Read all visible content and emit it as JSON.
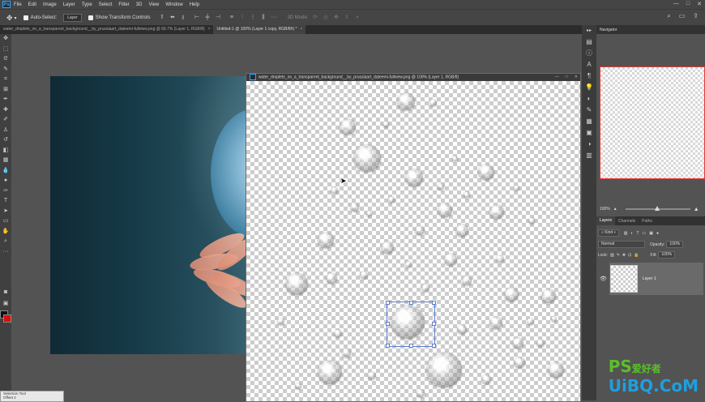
{
  "menu": [
    "File",
    "Edit",
    "Image",
    "Layer",
    "Type",
    "Select",
    "Filter",
    "3D",
    "View",
    "Window",
    "Help"
  ],
  "options": {
    "autoselect_label": "Auto-Select:",
    "autoselect_value": "Layer",
    "transform_label": "Show Transform Controls",
    "mode3d_label": "3D Mode:"
  },
  "tabs": [
    {
      "label": "water_droplets_on_a_transparent_background__by_prussiaart_dateemi-fullview.png @ 66.7% (Layer 1, RGB/8)",
      "active": false
    },
    {
      "label": "Untitled-1 @ 100% (Layer 1 copy, RGB/8#) *",
      "active": true
    }
  ],
  "floating_window": {
    "title": "water_droplets_on_a_transparent_background__by_prussiaart_dateemi-fullview.png @ 100% (Layer 1, RGB/8)"
  },
  "navigator": {
    "title": "Navigator",
    "zoom": "100%"
  },
  "layers_panel": {
    "tabs": [
      "Layers",
      "Channels",
      "Paths"
    ],
    "filter_label": "Kind",
    "blend_mode": "Normal",
    "opacity_label": "Opacity:",
    "opacity_value": "100%",
    "lock_label": "Lock:",
    "fill_label": "Fill:",
    "fill_value": "100%",
    "layer_name": "Layer 1"
  },
  "dialog": {
    "line1": "Selection Tool",
    "line2": "Offset 2"
  },
  "watermark": {
    "part1": "PS",
    "part2": "爱好者",
    "part3": "UiBQ.CoM"
  },
  "colors": {
    "foreground": "#111111",
    "background": "#d90f0f",
    "selection": "#5a7fd1"
  }
}
